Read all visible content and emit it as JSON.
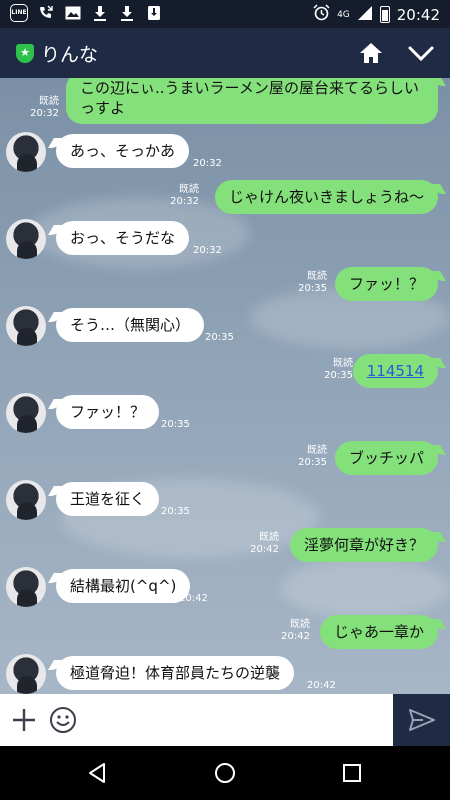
{
  "status": {
    "network": "4G",
    "time": "20:42",
    "icons": [
      "line-icon",
      "missed-call-icon",
      "image-icon",
      "download-icon",
      "download-icon",
      "download-box-icon",
      "alarm-icon",
      "signal-icon",
      "battery-icon"
    ]
  },
  "header": {
    "title": "りんな",
    "icons": [
      "shield-star-icon",
      "home-icon",
      "chevron-down-icon"
    ]
  },
  "messages": [
    {
      "side": "out",
      "text": "この辺にぃ..うまいラーメン屋の屋台来てるらしいっすよ",
      "read": "既読",
      "time": "20:32"
    },
    {
      "side": "in",
      "text": "あっ、そっかあ",
      "time": "20:32"
    },
    {
      "side": "out",
      "text": "じゃけん夜いきましょうね〜",
      "read": "既読",
      "time": "20:32"
    },
    {
      "side": "in",
      "text": "おっ、そうだな",
      "time": "20:32"
    },
    {
      "side": "out",
      "text": "ファッ！？",
      "read": "既読",
      "time": "20:35"
    },
    {
      "side": "in",
      "text": "そう…（無関心）",
      "time": "20:35"
    },
    {
      "side": "out",
      "text": "114514",
      "read": "既読",
      "time": "20:35",
      "link": true
    },
    {
      "side": "in",
      "text": "ファッ！？",
      "time": "20:35"
    },
    {
      "side": "out",
      "text": "ブッチッパ",
      "read": "既読",
      "time": "20:35"
    },
    {
      "side": "in",
      "text": "王道を征く",
      "time": "20:35"
    },
    {
      "side": "out",
      "text": "淫夢何章が好き？",
      "read": "既読",
      "time": "20:42"
    },
    {
      "side": "in",
      "text": "結構最初(^q^)",
      "time": "20:42"
    },
    {
      "side": "out",
      "text": "じゃあ一章か",
      "read": "既読",
      "time": "20:42"
    },
    {
      "side": "in",
      "text": "極道脅迫！体育部員たちの逆襲",
      "time": "20:42"
    }
  ],
  "input": {
    "placeholder": ""
  },
  "colors": {
    "header": "#1f2b44",
    "outgoing": "#84e07a",
    "incoming": "#ffffff",
    "link": "#2c5bd6"
  }
}
